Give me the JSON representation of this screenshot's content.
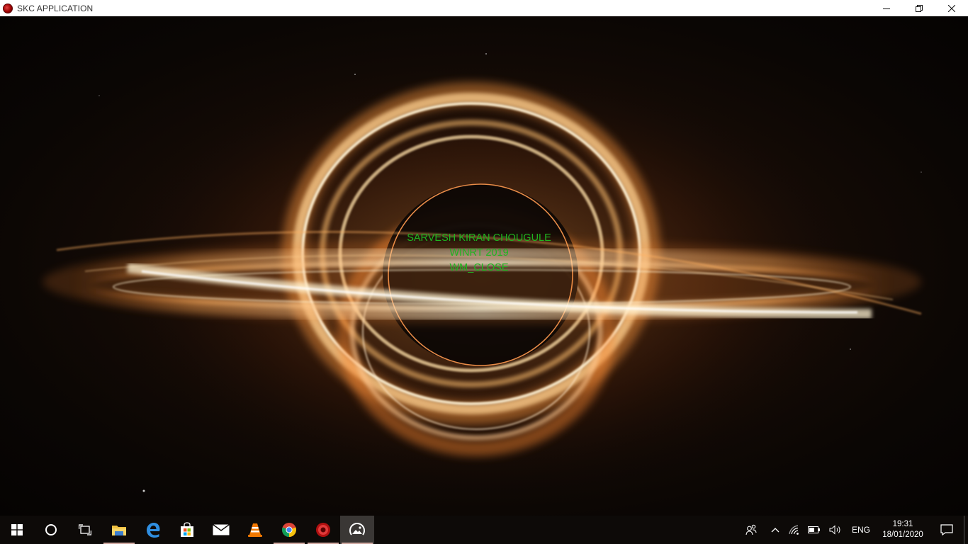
{
  "window": {
    "title": "SKC APPLICATION",
    "controls": {
      "minimize": "minimize",
      "maximize": "restore",
      "close": "close"
    }
  },
  "content": {
    "line1": "SARVESH KIRAN CHOUGULE",
    "line2": "WINRT 2019",
    "line3": "WM_CLOSE",
    "text_color": "#1fb51f"
  },
  "taskbar": {
    "apps": [
      {
        "name": "start",
        "icon": "windows-logo-icon"
      },
      {
        "name": "search",
        "icon": "cortana-circle-icon"
      },
      {
        "name": "task-view",
        "icon": "task-view-icon"
      },
      {
        "name": "file-explorer",
        "icon": "folder-icon",
        "running": true
      },
      {
        "name": "edge",
        "icon": "edge-icon"
      },
      {
        "name": "store",
        "icon": "store-bag-icon"
      },
      {
        "name": "mail",
        "icon": "mail-icon"
      },
      {
        "name": "vlc",
        "icon": "vlc-cone-icon"
      },
      {
        "name": "chrome",
        "icon": "chrome-icon",
        "running": true
      },
      {
        "name": "skc-app",
        "icon": "red-circle-app-icon",
        "running": true
      },
      {
        "name": "photos",
        "icon": "photos-icon",
        "active": true
      }
    ],
    "tray": {
      "language": "ENG",
      "time": "19:31",
      "date": "18/01/2020"
    }
  }
}
